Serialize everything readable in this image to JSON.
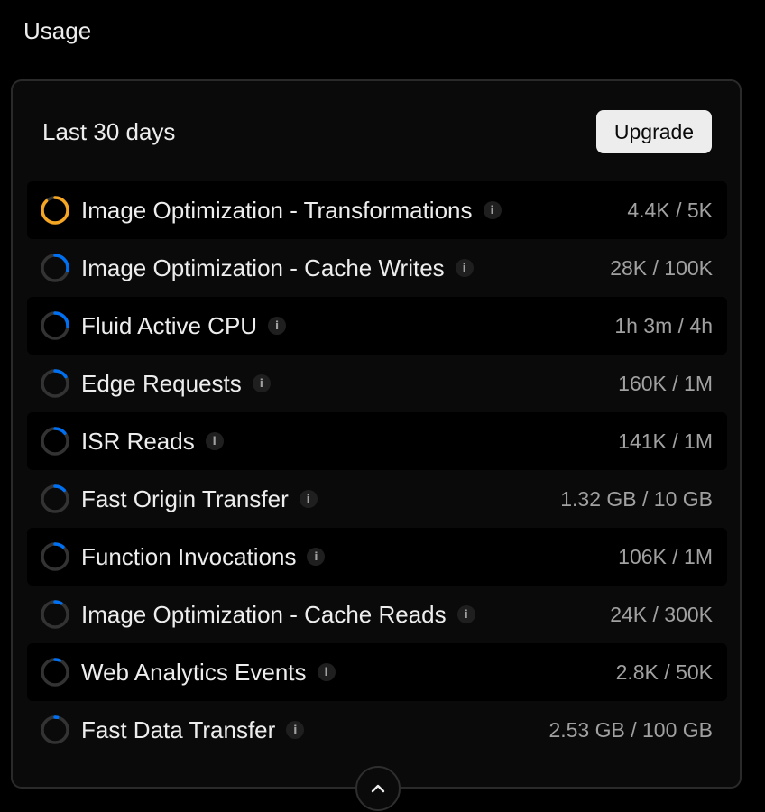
{
  "section": {
    "title": "Usage"
  },
  "card": {
    "period_label": "Last 30 days",
    "upgrade_label": "Upgrade"
  },
  "colors": {
    "warning": "#f5a623",
    "accent": "#0070f3",
    "track": "#333333"
  },
  "icons": {
    "info": "info-icon",
    "collapse": "chevron-up-icon"
  },
  "usage": [
    {
      "label": "Image Optimization - Transformations",
      "value": "4.4K / 5K",
      "progress": 0.88,
      "status": "warning"
    },
    {
      "label": "Image Optimization - Cache Writes",
      "value": "28K / 100K",
      "progress": 0.28,
      "status": "normal"
    },
    {
      "label": "Fluid Active CPU",
      "value": "1h 3m / 4h",
      "progress": 0.26,
      "status": "normal"
    },
    {
      "label": "Edge Requests",
      "value": "160K / 1M",
      "progress": 0.16,
      "status": "normal"
    },
    {
      "label": "ISR Reads",
      "value": "141K / 1M",
      "progress": 0.14,
      "status": "normal"
    },
    {
      "label": "Fast Origin Transfer",
      "value": "1.32 GB / 10 GB",
      "progress": 0.13,
      "status": "normal"
    },
    {
      "label": "Function Invocations",
      "value": "106K / 1M",
      "progress": 0.11,
      "status": "normal"
    },
    {
      "label": "Image Optimization - Cache Reads",
      "value": "24K / 300K",
      "progress": 0.08,
      "status": "normal"
    },
    {
      "label": "Web Analytics Events",
      "value": "2.8K / 50K",
      "progress": 0.06,
      "status": "normal"
    },
    {
      "label": "Fast Data Transfer",
      "value": "2.53 GB / 100 GB",
      "progress": 0.03,
      "status": "normal"
    }
  ]
}
